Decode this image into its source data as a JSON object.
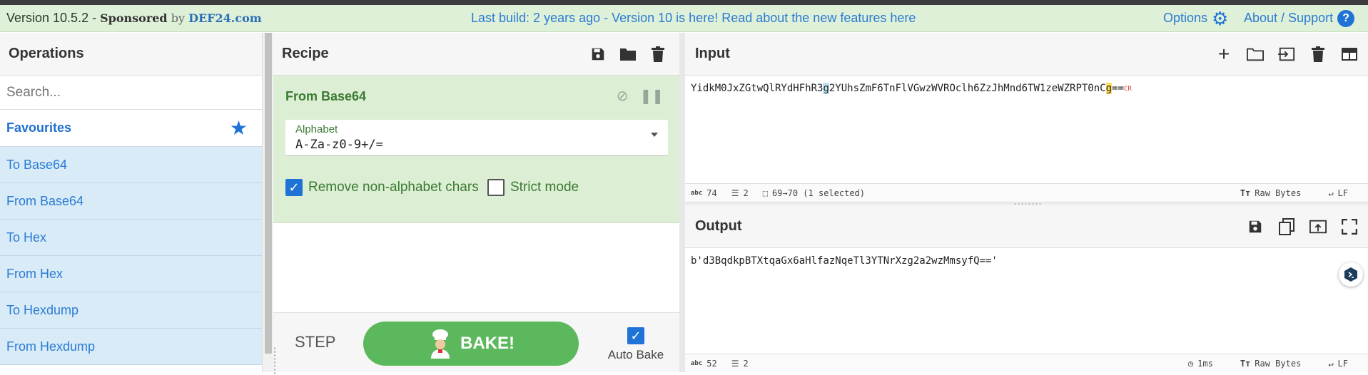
{
  "banner": {
    "version": "Version 10.5.2 - ",
    "sponsored": "Sponsored",
    "by": " by ",
    "sponsor": "DEF24.com",
    "notice": "Last build: 2 years ago - Version 10 is here! Read about the new features here",
    "options": "Options",
    "about": "About / Support",
    "about_icon": "?"
  },
  "operations": {
    "title": "Operations",
    "search_placeholder": "Search...",
    "favourites": "Favourites",
    "items": [
      "To Base64",
      "From Base64",
      "To Hex",
      "From Hex",
      "To Hexdump",
      "From Hexdump"
    ]
  },
  "recipe": {
    "title": "Recipe",
    "operation": {
      "title": "From Base64",
      "alphabet_label": "Alphabet",
      "alphabet_value": "A-Za-z0-9+/=",
      "remove_label": "Remove non-alphabet chars",
      "remove_checked": true,
      "strict_label": "Strict mode",
      "strict_checked": false
    },
    "step_label": "STEP",
    "bake_label": "BAKE!",
    "auto_bake_label": "Auto Bake",
    "auto_bake_checked": true
  },
  "input": {
    "title": "Input",
    "text_a": "YidkM0JxZGtwQlRYdHFhR3",
    "text_sel": "g",
    "text_b": "2YUhsZmF6TnFlVGwzWVROclh6ZzJhMnd6TW1zeWZRPT0nC",
    "text_hl": "g",
    "text_c": "==",
    "cr": "CR",
    "chars_icon": "abc",
    "chars": "74",
    "lines": "2",
    "selection": "69→70 (1 selected)",
    "format": "Raw Bytes",
    "eol": "LF"
  },
  "output": {
    "title": "Output",
    "text": "b'd3BqdkpBTXtqaGx6aHlfazNqeTl3YTNrXzg2a2wzMmsyfQ=='",
    "chars_icon": "abc",
    "chars": "52",
    "lines": "2",
    "time": "1ms",
    "format": "Raw Bytes",
    "eol": "LF"
  },
  "colors": {
    "banner_bg": "#dff0d8",
    "accent": "#1f73d6",
    "recipe_green": "#3c7a34",
    "bake_green": "#5cb85c",
    "op_bg": "#d9ebf7"
  }
}
